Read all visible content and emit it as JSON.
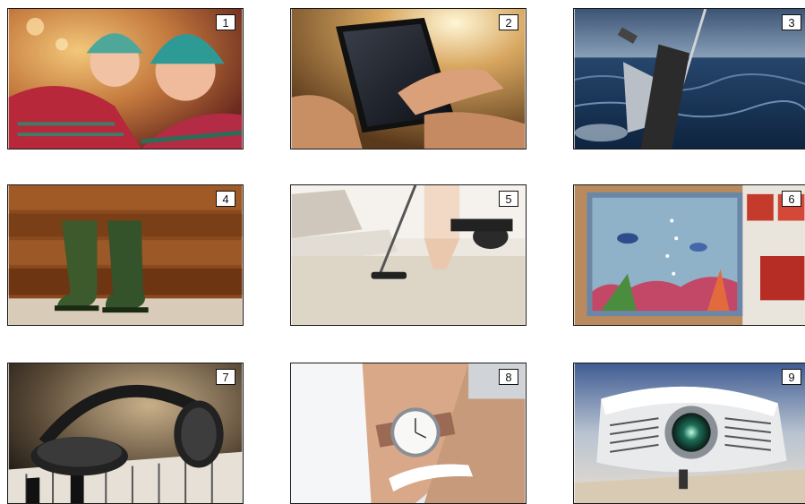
{
  "grid": {
    "tiles": [
      {
        "number": "1",
        "subject": "mother-and-daughter-in-winter-hats"
      },
      {
        "number": "2",
        "subject": "smartphone-touchscreen"
      },
      {
        "number": "3",
        "subject": "fishing-rod-on-boat-at-sea"
      },
      {
        "number": "4",
        "subject": "rubber-boots-against-wood-wall"
      },
      {
        "number": "5",
        "subject": "vacuuming-carpet"
      },
      {
        "number": "6",
        "subject": "home-aquarium"
      },
      {
        "number": "7",
        "subject": "headphones-on-piano-keys"
      },
      {
        "number": "8",
        "subject": "wristwatch-on-wrist"
      },
      {
        "number": "9",
        "subject": "video-projector"
      }
    ]
  }
}
